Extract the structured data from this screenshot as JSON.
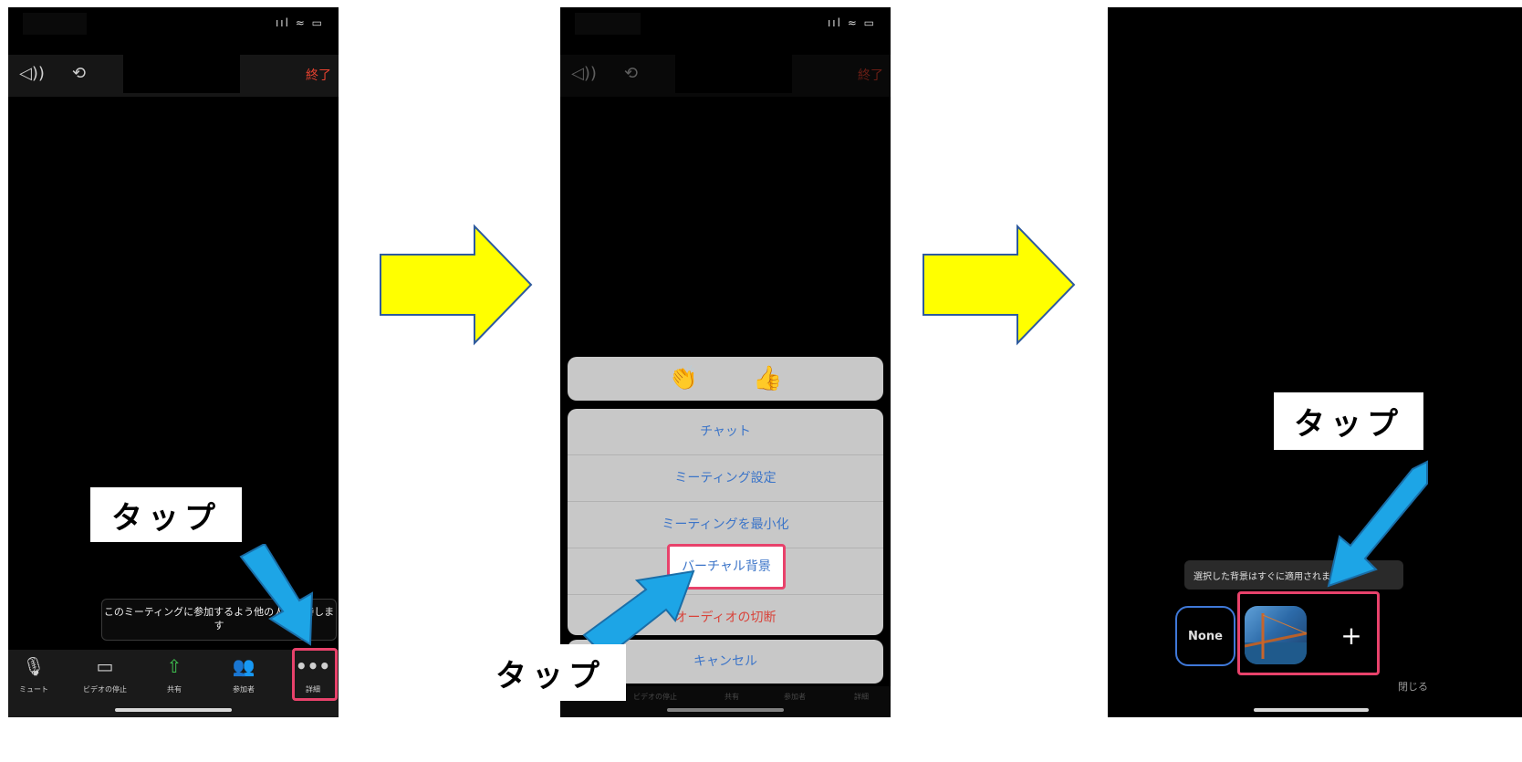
{
  "colors": {
    "arrow_yellow": "#ffff00",
    "arrow_blue": "#1da5e6",
    "highlight_pink": "#e8426b",
    "end_red": "#e8422f",
    "link_blue": "#3b74c8"
  },
  "tap_label": "タップ",
  "screen1": {
    "status_icons": "ııl ≈ ▭",
    "end_label": "終了",
    "tooltip": "このミーティングに参加するよう他の人を招待します",
    "toolbar": [
      {
        "icon": "mic-icon",
        "glyph": "🎙",
        "label": "ミュート"
      },
      {
        "icon": "video-icon",
        "glyph": "▭",
        "label": "ビデオの停止"
      },
      {
        "icon": "share-icon",
        "glyph": "⇧",
        "label": "共有"
      },
      {
        "icon": "participants-icon",
        "glyph": "👥",
        "label": "参加者"
      },
      {
        "icon": "more-icon",
        "glyph": "•••",
        "label": "詳細"
      }
    ]
  },
  "screen2": {
    "status_icons": "ııl ≈ ▭",
    "end_label": "終了",
    "reactions": [
      "👏",
      "👍"
    ],
    "menu": [
      "チャット",
      "ミーティング設定",
      "ミーティングを最小化",
      "バーチャル背景",
      "オーディオの切断"
    ],
    "cancel": "キャンセル",
    "toolbar": [
      "ビデオの停止",
      "共有",
      "参加者",
      "詳細"
    ]
  },
  "screen3": {
    "caption": "選択した背景はすぐに適用されます",
    "none_label": "None",
    "add_label": "+",
    "close_label": "閉じる"
  }
}
